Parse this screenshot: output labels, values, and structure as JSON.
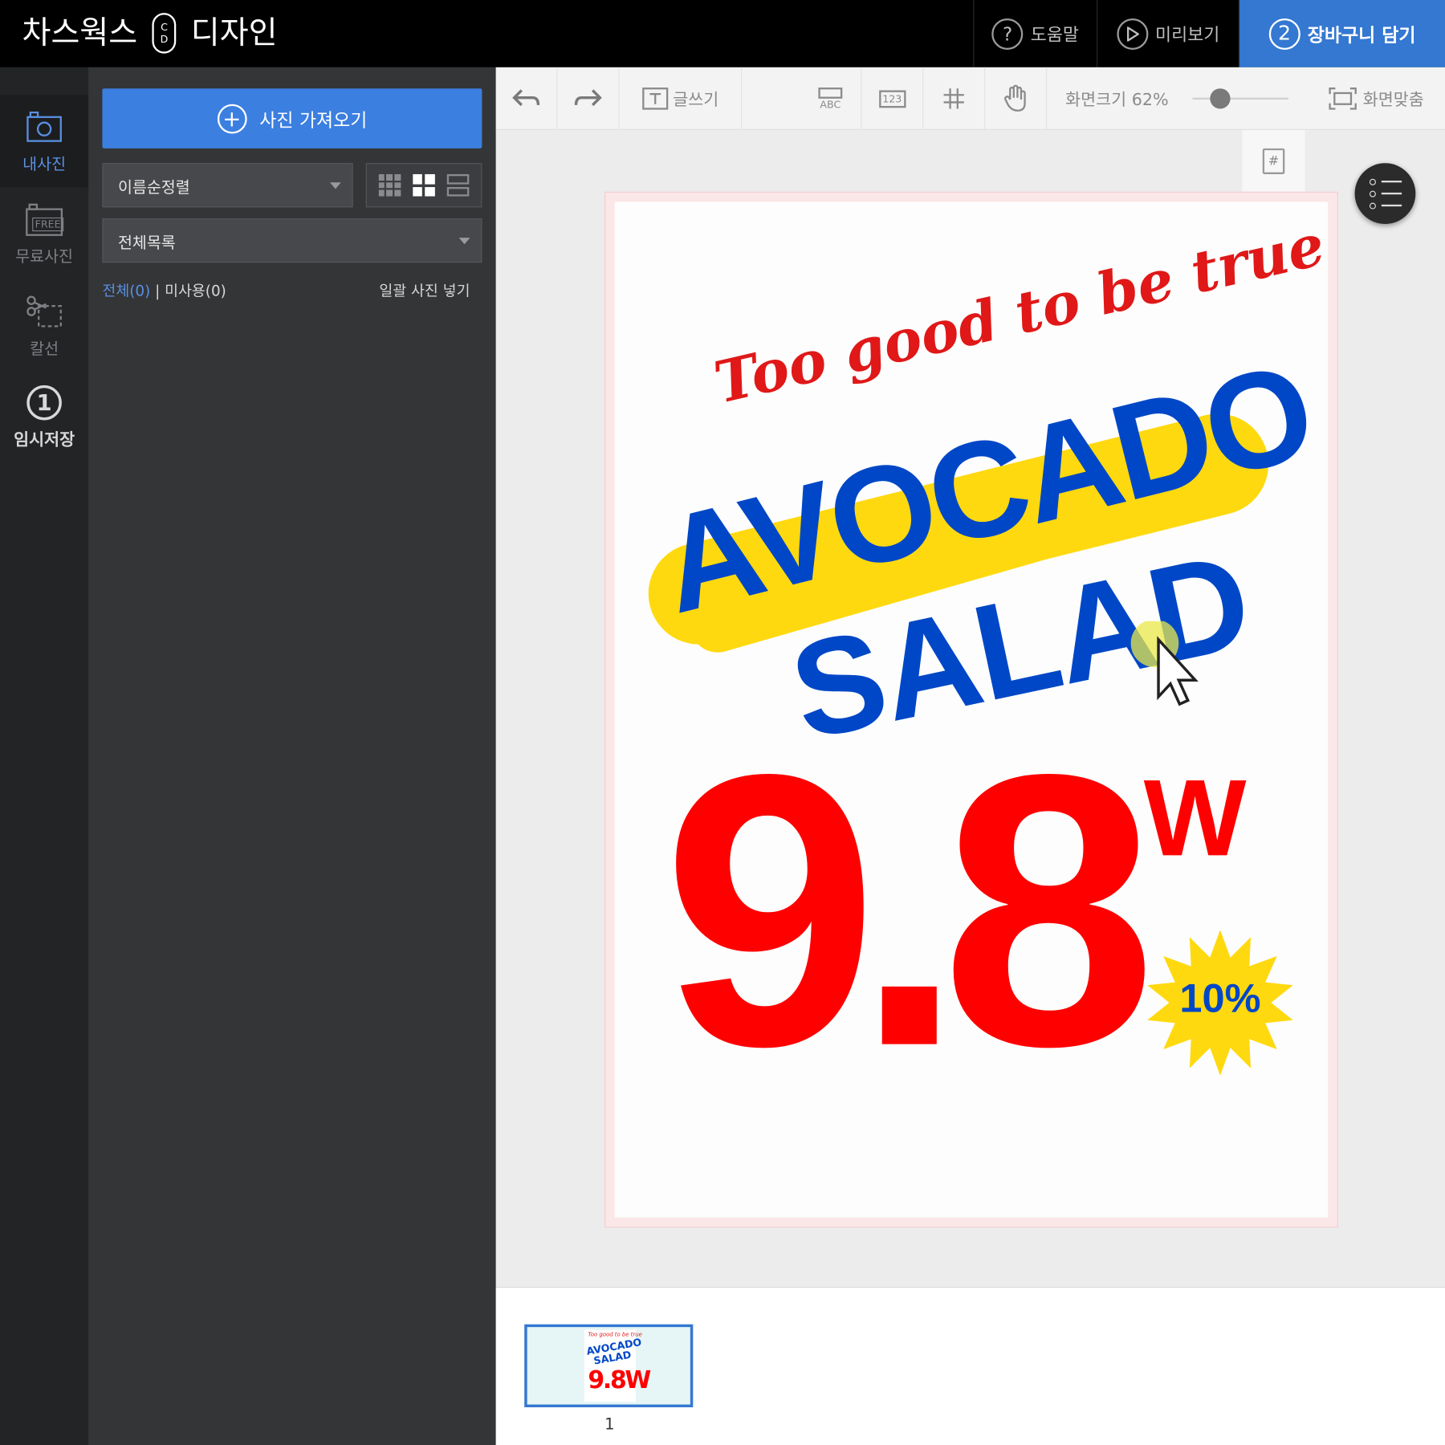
{
  "header": {
    "logo_left": "차스웍스",
    "logo_mark_top": "C",
    "logo_mark_bottom": "D",
    "logo_right": "디자인",
    "help_icon": "?",
    "help_label": "도움말",
    "preview_label": "미리보기",
    "cart_step": "2",
    "cart_label": "장바구니 담기"
  },
  "rail": {
    "my_photos": "내사진",
    "free_photos": "무료사진",
    "free_badge": "FREE",
    "cutline": "칼선",
    "temp_save_step": "1",
    "temp_save": "임시저장"
  },
  "panel": {
    "import_label": "사진 가져오기",
    "sort_value": "이름순정렬",
    "list_value": "전체목록",
    "filter_all": "전체(0)",
    "filter_sep": " | ",
    "filter_unused": "미사용(0)",
    "bulk_insert": "일괄 사진 넣기"
  },
  "toolbar": {
    "write_text": "글쓰기",
    "abc_icon": "ABC",
    "num_icon": "123",
    "zoom_label": "화면크기 62%",
    "zoom_percent": 62,
    "fit_label": "화면맞춤"
  },
  "canvas": {
    "page_number_icon": "#"
  },
  "poster": {
    "script": "Too good to be true",
    "line1": "AVOCADO",
    "line2": "SALAD",
    "price": "9.8",
    "currency": "W",
    "discount": "10%"
  },
  "thumbnails": [
    {
      "number": "1",
      "script": "Too good to be true",
      "line1": "AVOCADO",
      "line2": "SALAD",
      "price": "9.8W"
    }
  ],
  "colors": {
    "accent_blue": "#3478d1",
    "poster_red": "#ff0000",
    "poster_blue": "#0047c7",
    "poster_yellow": "#ffd90f"
  }
}
